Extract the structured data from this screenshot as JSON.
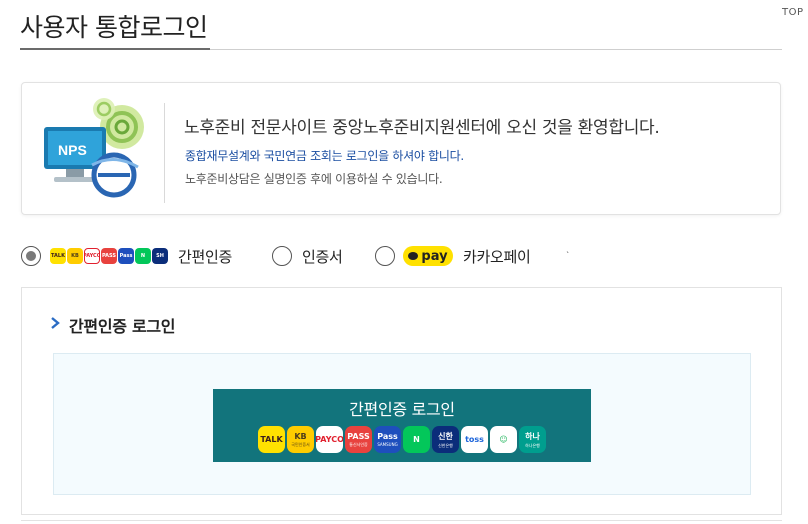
{
  "top_link": "TOP",
  "page": {
    "title": "사용자 통합로그인"
  },
  "welcome": {
    "badge_text": "NPS",
    "title": "노후준비 전문사이트 중앙노후준비지원센터에 오신 것을 환영합니다.",
    "notice": "종합재무설계와 국민연금 조회는 로그인을 하셔야 합니다.",
    "sub": "노후준비상담은 실명인증 후에 이용하실 수 있습니다."
  },
  "options": [
    {
      "label": "간편인증",
      "selected": true
    },
    {
      "label": "인증서",
      "selected": false
    },
    {
      "label": "카카오페이",
      "selected": false,
      "pill": "pay"
    }
  ],
  "mini_icons": [
    {
      "name": "kakao-talk-mini-icon",
      "text": "TALK",
      "bg": "#ffe100",
      "fg": "#3b1e1e"
    },
    {
      "name": "kb-mini-icon",
      "text": "KB",
      "bg": "#ffcc00",
      "fg": "#4d3b1a"
    },
    {
      "name": "payco-mini-icon",
      "text": "PAYCO",
      "bg": "#ffffff",
      "fg": "#e1202e"
    },
    {
      "name": "pass-mini-icon",
      "text": "PASS",
      "bg": "#e8423e",
      "fg": "#ffffff"
    },
    {
      "name": "samsung-pass-mini-icon",
      "text": "Pass",
      "bg": "#1e4fbd",
      "fg": "#ffffff"
    },
    {
      "name": "naver-mini-icon",
      "text": "N",
      "bg": "#03c75a",
      "fg": "#ffffff"
    },
    {
      "name": "shinhan-mini-icon",
      "text": "SH",
      "bg": "#0b2d7a",
      "fg": "#ffffff"
    }
  ],
  "panel": {
    "title": "간편인증 로그인",
    "button_label": "간편인증 로그인"
  },
  "providers": [
    {
      "name": "kakao-provider-icon",
      "text": "TALK",
      "bg": "#ffe100",
      "fg": "#3b1e1e",
      "sub": ""
    },
    {
      "name": "kb-provider-icon",
      "text": "KB",
      "bg": "#ffcc00",
      "fg": "#4d3b1a",
      "sub": "국민인증서"
    },
    {
      "name": "payco-provider-icon",
      "text": "PAYCO",
      "bg": "#ffffff",
      "fg": "#e1202e",
      "sub": ""
    },
    {
      "name": "pass-provider-icon",
      "text": "PASS",
      "bg": "#e8423e",
      "fg": "#ffffff",
      "sub": "통신사인증"
    },
    {
      "name": "samsung-pass-provider-icon",
      "text": "Pass",
      "bg": "#1e4fbd",
      "fg": "#ffffff",
      "sub": "SAMSUNG"
    },
    {
      "name": "naver-provider-icon",
      "text": "N",
      "bg": "#03c75a",
      "fg": "#ffffff",
      "sub": ""
    },
    {
      "name": "shinhan-provider-icon",
      "text": "신한",
      "bg": "#0b2d7a",
      "fg": "#ffffff",
      "sub": "신한은행"
    },
    {
      "name": "toss-provider-icon",
      "text": "toss",
      "bg": "#ffffff",
      "fg": "#1b64da",
      "sub": ""
    },
    {
      "name": "banksalad-provider-icon",
      "text": "☺",
      "bg": "#ffffff",
      "fg": "#1fb55b",
      "sub": ""
    },
    {
      "name": "hana-provider-icon",
      "text": "하나",
      "bg": "#009e8e",
      "fg": "#ffffff",
      "sub": "하나은행"
    }
  ]
}
